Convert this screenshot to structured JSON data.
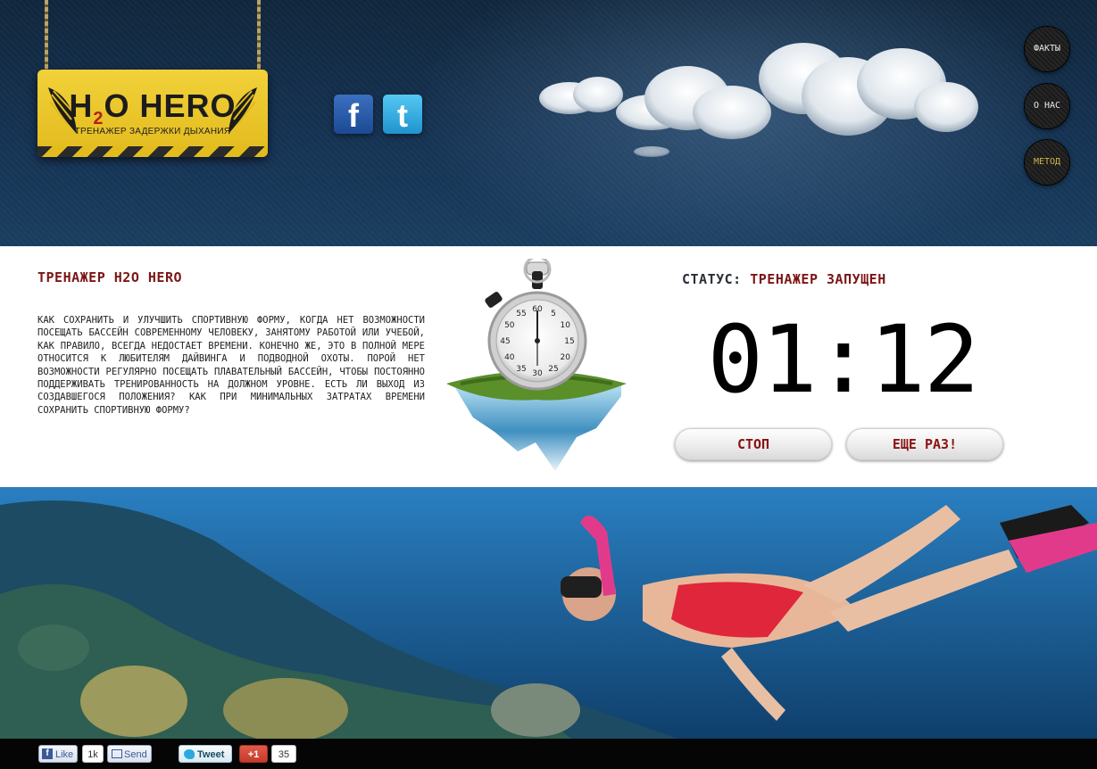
{
  "header": {
    "logo": {
      "title_pre": "H",
      "title_sub": "2",
      "title_post": "O HERO",
      "tagline": "ТРЕНАЖЕР ЗАДЕРЖКИ ДЫХАНИЯ"
    },
    "social": {
      "facebook_icon": "facebook-icon",
      "twitter_icon": "twitter-icon",
      "facebook_glyph": "f",
      "twitter_glyph": "t"
    },
    "nav": [
      {
        "label": "ФАКТЫ",
        "active": false
      },
      {
        "label": "О НАС",
        "active": false
      },
      {
        "label": "МЕТОД",
        "active": true
      }
    ]
  },
  "main": {
    "title": "ТРЕНАЖЕР H2O HERO",
    "description": "КАК СОХРАНИТЬ И УЛУЧШИТЬ СПОРТИВНУЮ ФОРМУ, КОГДА НЕТ ВОЗМОЖНОСТИ ПОСЕЩАТЬ БАССЕЙН СОВРЕМЕННОМУ ЧЕЛОВЕКУ, ЗАНЯТОМУ РАБОТОЙ ИЛИ УЧЕБОЙ, КАК ПРАВИЛО, ВСЕГДА НЕДОСТАЕТ ВРЕМЕНИ. КОНЕЧНО ЖЕ, ЭТО В ПОЛНОЙ МЕРЕ ОТНОСИТСЯ К ЛЮБИТЕЛЯМ ДАЙВИНГА И ПОДВОДНОЙ ОХОТЫ. ПОРОЙ НЕТ ВОЗМОЖНОСТИ РЕГУЛЯРНО ПОСЕЩАТЬ ПЛАВАТЕЛЬНЫЙ БАССЕЙН, ЧТОБЫ ПОСТОЯННО ПОДДЕРЖИВАТЬ ТРЕНИРОВАННОСТЬ НА ДОЛЖНОМ УРОВНЕ. ЕСТЬ ЛИ ВЫХОД ИЗ СОЗДАВШЕГОСЯ ПОЛОЖЕНИЯ? КАК ПРИ МИНИМАЛЬНЫХ ЗАТРАТАХ ВРЕМЕНИ СОХРАНИТЬ СПОРТИВНУЮ ФОРМУ?",
    "stopwatch_numbers": [
      "60",
      "5",
      "10",
      "15",
      "20",
      "25",
      "30",
      "35",
      "40",
      "45",
      "50",
      "55"
    ],
    "status_label": "СТАТУС:",
    "status_value": "ТРЕНАЖЕР ЗАПУЩЕН",
    "timer": "01:12",
    "stop_label": "СТОП",
    "again_label": "ЕЩЕ РАЗ!"
  },
  "share_bar": {
    "fb_like_label": "Like",
    "fb_like_glyph": "f",
    "fb_like_count": "1k",
    "fb_send_label": "Send",
    "tweet_label": "Tweet",
    "gplus_label": "+1",
    "gplus_count": "35"
  },
  "colors": {
    "accent_red": "#7b1616",
    "sign_yellow": "#e2bb1d",
    "header_blue": "#153252"
  }
}
